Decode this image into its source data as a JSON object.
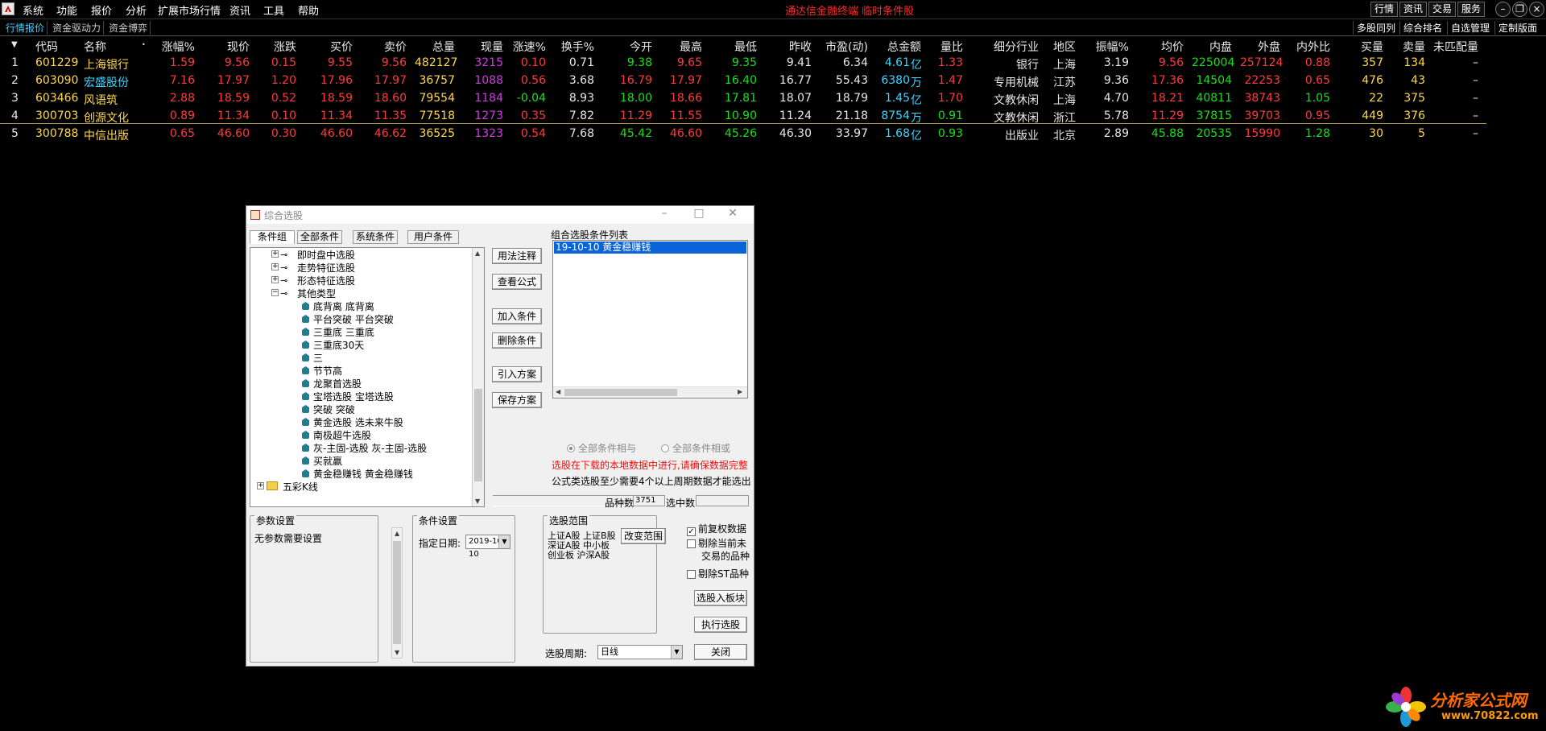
{
  "menu": [
    "系统",
    "功能",
    "报价",
    "分析",
    "扩展市场行情",
    "资讯",
    "工具",
    "帮助"
  ],
  "center_title": "通达信金融终端 临时条件股",
  "right_buttons": [
    "行情",
    "资讯",
    "交易",
    "服务"
  ],
  "tabs": {
    "left": [
      "行情报价",
      "资金驱动力",
      "资金博弈"
    ],
    "right": [
      "多股同列",
      "综合排名",
      "自选管理",
      "定制版面"
    ]
  },
  "table": {
    "headers": [
      "代码",
      "名称",
      "涨幅%",
      "现价",
      "涨跌",
      "买价",
      "卖价",
      "总量",
      "现量",
      "涨速%",
      "换手%",
      "今开",
      "最高",
      "最低",
      "昨收",
      "市盈(动)",
      "总金额",
      "量比",
      "细分行业",
      "地区",
      "振幅%",
      "均价",
      "内盘",
      "外盘",
      "内外比",
      "买量",
      "卖量",
      "未匹配量"
    ],
    "rows": [
      {
        "idx": "1",
        "code": "601229",
        "name": "上海银行",
        "chg_pct": "1.59",
        "price": "9.56",
        "chg": "0.15",
        "bid": "9.55",
        "ask": "9.56",
        "vol": "482127",
        "cur_vol": "3215",
        "speed": "0.10",
        "turnover": "0.71",
        "open": "9.38",
        "high": "9.65",
        "low": "9.35",
        "prev": "9.41",
        "pe": "6.34",
        "amount": "4.61",
        "amount_unit": "亿",
        "vol_ratio": "1.33",
        "industry": "银行",
        "region": "上海",
        "amplitude": "3.19",
        "avg": "9.56",
        "inner": "225004",
        "outer": "257124",
        "io_ratio": "0.88",
        "bid_vol": "357",
        "ask_vol": "134",
        "unmatched": "–"
      },
      {
        "idx": "2",
        "code": "603090",
        "name": "宏盛股份",
        "chg_pct": "7.16",
        "price": "17.97",
        "chg": "1.20",
        "bid": "17.96",
        "ask": "17.97",
        "vol": "36757",
        "cur_vol": "1088",
        "speed": "0.56",
        "turnover": "3.68",
        "open": "16.79",
        "high": "17.97",
        "low": "16.40",
        "prev": "16.77",
        "pe": "55.43",
        "amount": "6380",
        "amount_unit": "万",
        "vol_ratio": "1.47",
        "industry": "专用机械",
        "region": "江苏",
        "amplitude": "9.36",
        "avg": "17.36",
        "inner": "14504",
        "outer": "22253",
        "io_ratio": "0.65",
        "bid_vol": "476",
        "ask_vol": "43",
        "unmatched": "–"
      },
      {
        "idx": "3",
        "code": "603466",
        "name": "风语筑",
        "chg_pct": "2.88",
        "price": "18.59",
        "chg": "0.52",
        "bid": "18.59",
        "ask": "18.60",
        "vol": "79554",
        "cur_vol": "1184",
        "speed": "-0.04",
        "turnover": "8.93",
        "open": "18.00",
        "high": "18.66",
        "low": "17.81",
        "prev": "18.07",
        "pe": "18.79",
        "amount": "1.45",
        "amount_unit": "亿",
        "vol_ratio": "1.70",
        "industry": "文教休闲",
        "region": "上海",
        "amplitude": "4.70",
        "avg": "18.21",
        "inner": "40811",
        "outer": "38743",
        "io_ratio": "1.05",
        "bid_vol": "22",
        "ask_vol": "375",
        "unmatched": "–"
      },
      {
        "idx": "4",
        "code": "300703",
        "name": "创源文化",
        "chg_pct": "0.89",
        "price": "11.34",
        "chg": "0.10",
        "bid": "11.34",
        "ask": "11.35",
        "vol": "77518",
        "cur_vol": "1273",
        "speed": "0.35",
        "turnover": "7.82",
        "open": "11.29",
        "high": "11.55",
        "low": "10.90",
        "prev": "11.24",
        "pe": "21.18",
        "amount": "8754",
        "amount_unit": "万",
        "vol_ratio": "0.91",
        "industry": "文教休闲",
        "region": "浙江",
        "amplitude": "5.78",
        "avg": "11.29",
        "inner": "37815",
        "outer": "39703",
        "io_ratio": "0.95",
        "bid_vol": "449",
        "ask_vol": "376",
        "unmatched": "–"
      },
      {
        "idx": "5",
        "code": "300788",
        "name": "中信出版",
        "chg_pct": "0.65",
        "price": "46.60",
        "chg": "0.30",
        "bid": "46.60",
        "ask": "46.62",
        "vol": "36525",
        "cur_vol": "1323",
        "speed": "0.54",
        "turnover": "7.68",
        "open": "45.42",
        "high": "46.60",
        "low": "45.26",
        "prev": "46.30",
        "pe": "33.97",
        "amount": "1.68",
        "amount_unit": "亿",
        "vol_ratio": "0.93",
        "industry": "出版业",
        "region": "北京",
        "amplitude": "2.89",
        "avg": "45.88",
        "inner": "20535",
        "outer": "15990",
        "io_ratio": "1.28",
        "bid_vol": "30",
        "ask_vol": "5",
        "unmatched": "–"
      }
    ]
  },
  "dialog": {
    "title": "综合选股",
    "tabs": [
      "条件组",
      "全部条件",
      "系统条件",
      "用户条件"
    ],
    "tree": [
      {
        "label": "即时盘中选股",
        "type": "group",
        "expand": "+"
      },
      {
        "label": "走势特征选股",
        "type": "group",
        "expand": "+"
      },
      {
        "label": "形态特征选股",
        "type": "group",
        "expand": "+"
      },
      {
        "label": "其他类型",
        "type": "group",
        "expand": "−"
      },
      {
        "label": "底背离  底背离",
        "type": "leaf"
      },
      {
        "label": "平台突破  平台突破",
        "type": "leaf"
      },
      {
        "label": "三重底  三重底",
        "type": "leaf"
      },
      {
        "label": "三重底30天",
        "type": "leaf"
      },
      {
        "label": "三",
        "type": "leaf"
      },
      {
        "label": "节节高",
        "type": "leaf"
      },
      {
        "label": "龙聚首选股",
        "type": "leaf"
      },
      {
        "label": "宝塔选股  宝塔选股",
        "type": "leaf"
      },
      {
        "label": "突破  突破",
        "type": "leaf"
      },
      {
        "label": "黄金选股  选未来牛股",
        "type": "leaf"
      },
      {
        "label": "南极超牛选股",
        "type": "leaf"
      },
      {
        "label": "灰-主固-选股  灰-主固-选股",
        "type": "leaf"
      },
      {
        "label": "买就赢",
        "type": "leaf"
      },
      {
        "label": "黄金稳赚钱  黄金稳赚钱",
        "type": "leaf"
      },
      {
        "label": "五彩K线",
        "type": "folder",
        "expand": "+"
      }
    ],
    "mid_buttons": [
      "用法注释",
      "查看公式",
      "加入条件",
      "删除条件",
      "引入方案",
      "保存方案"
    ],
    "combo_label": "组合选股条件列表",
    "combo_item": "19-10-10  黄金稳赚钱",
    "radio_and": "全部条件相与",
    "radio_or": "全部条件相或",
    "warning": "选股在下载的本地数据中进行,请确保数据完整",
    "note": "公式类选股至少需要4个以上周期数据才能选出",
    "count_label": "品种数",
    "count_value": "3751",
    "selected_label": "选中数",
    "selected_value": "",
    "param_title": "参数设置",
    "param_text": "无参数需要设置",
    "cond_title": "条件设置",
    "date_label": "指定日期:",
    "date_value": "2019-10-10",
    "range_title": "选股范围",
    "range_text": [
      "上证A股  上证B股",
      "深证A股  中小板",
      "创业板  沪深A股"
    ],
    "change_range": "改变范围",
    "chk_prefq": "前复权数据",
    "chk_exclude_line1": "剔除当前未",
    "chk_exclude_line2": "交易的品种",
    "chk_st": "剔除ST品种",
    "btn_to_block": "选股入板块",
    "btn_execute": "执行选股",
    "btn_close": "关闭",
    "period_label": "选股周期:",
    "period_value": "日线"
  },
  "watermark": {
    "text": "分析家公式网",
    "url": "www.70822.com"
  }
}
